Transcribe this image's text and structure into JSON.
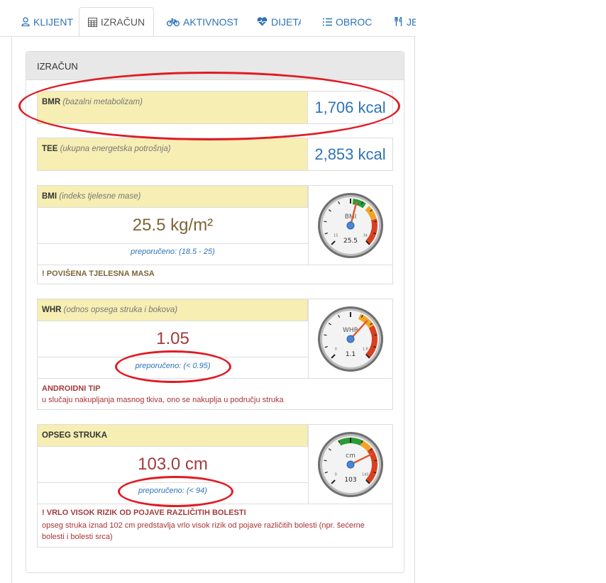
{
  "tabs": [
    {
      "label": "KLIJENT",
      "icon": "user-icon",
      "active": false
    },
    {
      "label": "IZRAČUN",
      "icon": "calculator-icon",
      "active": true
    },
    {
      "label": "AKTIVNOST",
      "icon": "bicycle-icon",
      "active": false
    },
    {
      "label": "DIJETA",
      "icon": "heartbeat-icon",
      "active": false
    },
    {
      "label": "OBROCI",
      "icon": "list-icon",
      "active": false
    },
    {
      "label": "JELA",
      "icon": "cutlery-icon",
      "active": false
    }
  ],
  "panel": {
    "title": "IZRAČUN"
  },
  "bmr": {
    "abbr": "BMR",
    "desc": "(bazalni metabolizam)",
    "value": "1,706 kcal"
  },
  "tee": {
    "abbr": "TEE",
    "desc": "(ukupna energetska potrošnja)",
    "value": "2,853 kcal"
  },
  "bmi": {
    "abbr": "BMI",
    "desc": "(indeks tjelesne mase)",
    "value": "25.5 kg/m²",
    "recommended": "preporučeno: (18.5 - 25)",
    "warning_mark": "!",
    "warning": "POVIŠENA TJELESNA MASA",
    "gauge": {
      "label": "BMI",
      "reading": "25.5",
      "min_label": "15",
      "max_label": "34",
      "min": 15,
      "max": 34,
      "value": 25.5
    }
  },
  "whr": {
    "abbr": "WHR",
    "desc": "(odnos opsega struka i bokova)",
    "value": "1.05",
    "recommended": "preporučeno: (< 0.95)",
    "note_title": "ANDROIDNI TIP",
    "note_text": "u slučaju nakupljanja masnog tkiva, ono se nakuplja u području struka",
    "gauge": {
      "label": "WHR",
      "reading": "1.1",
      "min_label": "0",
      "max_label": "1.6",
      "min": 0,
      "max": 1.6,
      "value": 1.05
    }
  },
  "waist": {
    "abbr": "OPSEG STRUKA",
    "value": "103.0 cm",
    "recommended": "preporučeno: (< 94)",
    "warning_mark": "!",
    "note_title": "VRLO VISOK RIZIK OD POJAVE RAZLIČITIH BOLESTI",
    "note_text": "opseg struka iznad 102 cm predstavlja vrlo visok rizik od pojave različitih bolesti (npr. šećerne bolesti i bolesti srca)",
    "gauge": {
      "label": "cm",
      "reading": "103",
      "min_label": "0",
      "max_label": "140",
      "min": 0,
      "max": 140,
      "value": 103
    }
  },
  "colors": {
    "accent": "#2e73b8",
    "value_brown": "#7d6537",
    "value_red": "#a33b3b",
    "highlight": "#f6eeb3",
    "annotation": "#e01b24"
  }
}
